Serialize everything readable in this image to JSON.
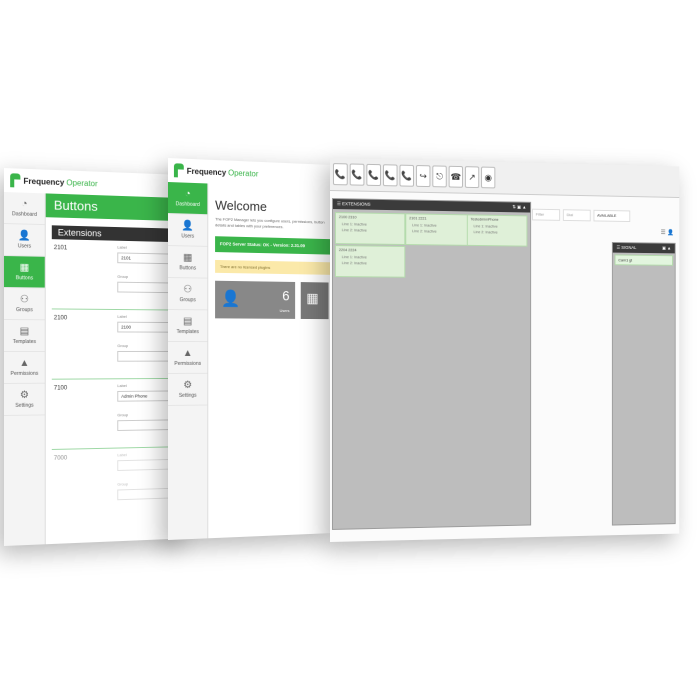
{
  "brand": {
    "name": "Frequency",
    "suffix": "Operator"
  },
  "buttons_window": {
    "nav": [
      {
        "label": "Dashboard",
        "icon": "dashboard-icon",
        "glyph": "◔"
      },
      {
        "label": "Users",
        "icon": "user-icon",
        "glyph": "👤"
      },
      {
        "label": "Buttons",
        "icon": "grid-icon",
        "glyph": "▦",
        "active": true
      },
      {
        "label": "Groups",
        "icon": "groups-icon",
        "glyph": "⚇"
      },
      {
        "label": "Templates",
        "icon": "template-icon",
        "glyph": "▤"
      },
      {
        "label": "Permissions",
        "icon": "warning-icon",
        "glyph": "▲"
      },
      {
        "label": "Settings",
        "icon": "gear-icon",
        "glyph": "⚙"
      }
    ],
    "header": "Buttons",
    "section": "Extensions",
    "label_caption": "Label",
    "group_caption": "Group",
    "rows": [
      {
        "ext": "2101",
        "label": "2101"
      },
      {
        "ext": "2100",
        "label": "2100"
      },
      {
        "ext": "7100",
        "label": "Admin Phone"
      },
      {
        "ext": "7000",
        "label": ""
      }
    ]
  },
  "dashboard_window": {
    "nav": [
      {
        "label": "Dashboard",
        "glyph": "◔",
        "active": true
      },
      {
        "label": "Users",
        "glyph": "👤"
      },
      {
        "label": "Buttons",
        "glyph": "▦"
      },
      {
        "label": "Groups",
        "glyph": "⚇"
      },
      {
        "label": "Templates",
        "glyph": "▤"
      },
      {
        "label": "Permissions",
        "glyph": "▲"
      },
      {
        "label": "Settings",
        "glyph": "⚙"
      }
    ],
    "title": "Welcome",
    "intro": "The FOP2 Manager lets you configure users, permissions, button details and tables with your preferences.",
    "status": "FOP2 Server Status: OK - Version: 2.31.09",
    "warning": "There are no licensed plugins",
    "users_count": "6",
    "users_caption": "Users"
  },
  "panel_window": {
    "toolbar": [
      "📞",
      "📞",
      "📞",
      "📞",
      "📞",
      "↪",
      "⎋",
      "☎",
      "↗",
      "◉"
    ],
    "filter_placeholder": "Filter",
    "dial_placeholder": "Dial",
    "presence": "AVAILABLE",
    "extensions_title": "EXTENSIONS",
    "queue_title": "SIGNAL",
    "queue_item": "Cam1 gt",
    "buttons": [
      {
        "title": "2100 2310",
        "lines": [
          "Line 1: Inactive",
          "Line 2: Inactive"
        ]
      },
      {
        "title": "2101 2221",
        "lines": [
          "Line 1: Inactive",
          "Line 2: Inactive"
        ]
      },
      {
        "title": "TestedmimPhone",
        "lines": [
          "Line 1: Inactive",
          "Line 2: Inactive"
        ]
      },
      {
        "title": "2204 2224",
        "lines": [
          "Line 1: Inactive",
          "Line 2: Inactive"
        ]
      }
    ]
  }
}
